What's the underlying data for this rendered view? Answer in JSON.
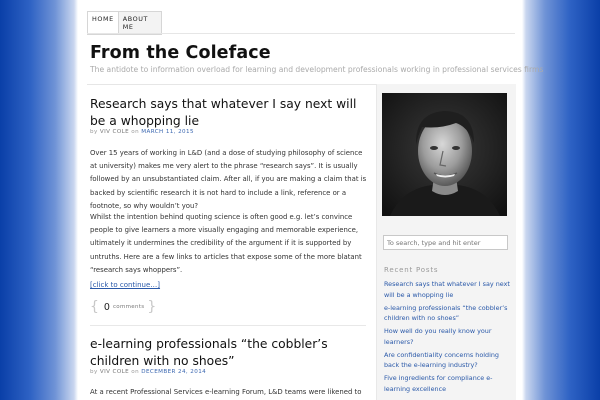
{
  "nav": {
    "home": "HOME",
    "about_line1": "ABOUT",
    "about_line2": "ME"
  },
  "site": {
    "title": "From the Coleface",
    "tagline": "The antidote to information overload for learning and development professionals working in professional services firms"
  },
  "posts": [
    {
      "title": "Research says that whatever I say next will be a whopping lie",
      "by": "by",
      "author": "VIV COLE",
      "on": "on",
      "date": "MARCH 11, 2015",
      "paragraphs": [
        "Over 15 years of working in L&D (and a dose of studying philosophy of science at university) makes me very alert to the phrase “research says”. It is usually followed by an unsubstantiated claim. After all, if you are making a claim that is backed by scientific research it is not hard to include a link, reference or a footnote, so why wouldn’t you?",
        "Whilst the intention behind quoting science is often good e.g. let’s convince people to give learners a more visually engaging and memorable experience, ultimately it undermines the credibility of the argument if it is supported by untruths. Here are a few links to articles that expose some of the more blatant “research says whoppers”."
      ],
      "more_link": "[click to continue…]",
      "comment_count": "0",
      "comment_label": "comments"
    },
    {
      "title": "e-learning professionals “the cobbler’s children with no shoes”",
      "by": "by",
      "author": "VIV COLE",
      "on": "on",
      "date": "DECEMBER 24, 2014",
      "paragraphs": [
        "At a recent Professional Services e-learning Forum, L&D teams were likened to"
      ]
    }
  ],
  "sidebar": {
    "search_placeholder": "To search, type and hit enter",
    "recent_title": "Recent Posts",
    "recent_posts": [
      "Research says that whatever I say next will be a whopping lie",
      "e-learning professionals “the cobbler’s children with no shoes”",
      "How well do you really know your learners?",
      "Are confidentiality concerns holding back the e-learning industry?",
      "Five ingredients for compliance e-learning excellence"
    ]
  },
  "colors": {
    "link": "#2958a8",
    "border_blue": "#0a3fa8"
  },
  "icons": {
    "author_photo": "author-portrait"
  }
}
